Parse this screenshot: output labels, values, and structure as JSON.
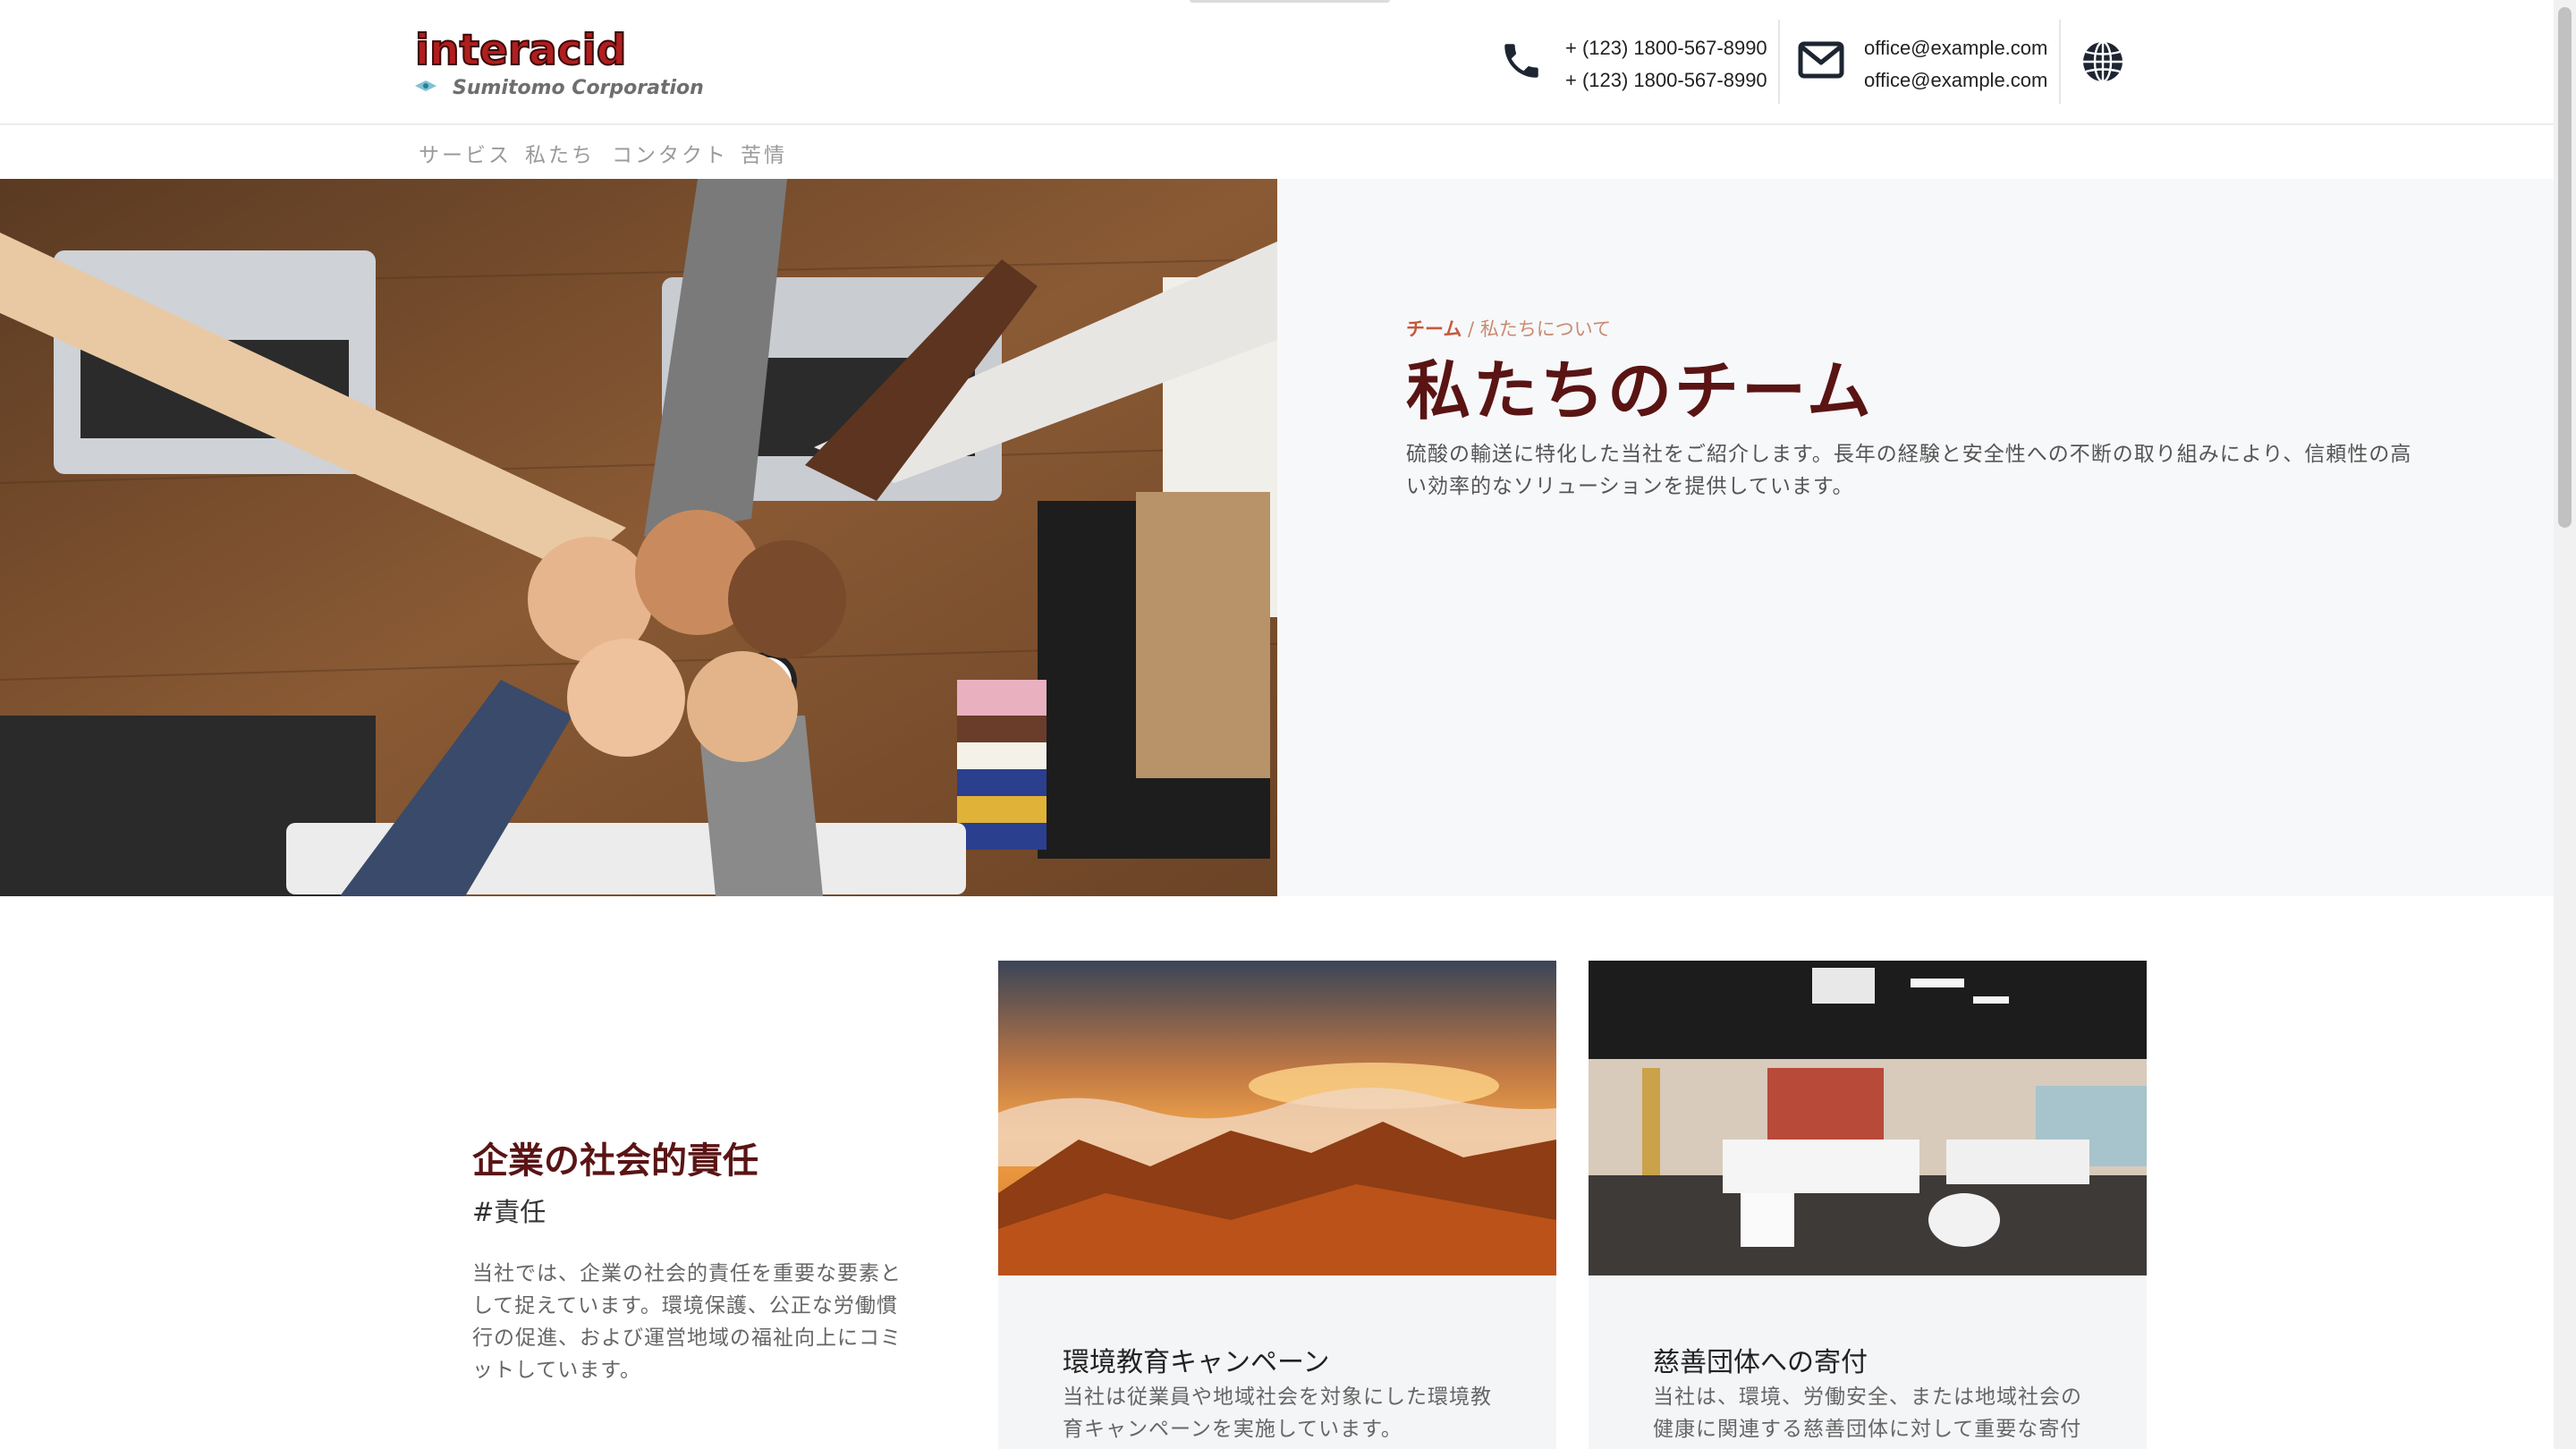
{
  "header": {
    "logo": {
      "wordmark": "interacid",
      "subtitle": "Sumitomo Corporation"
    },
    "phones": [
      "+ (123) 1800-567-8990",
      "+ (123) 1800-567-8990"
    ],
    "emails": [
      "office@example.com",
      "office@example.com"
    ],
    "icons": {
      "phone": "phone-icon",
      "email": "envelope-icon",
      "language": "globe-icon"
    }
  },
  "nav": {
    "items": [
      {
        "label": "サービス"
      },
      {
        "label": "私たち"
      },
      {
        "label": "コンタクト"
      },
      {
        "label": "苦情"
      }
    ]
  },
  "hero": {
    "breadcrumb_active": "チーム",
    "breadcrumb_rest": " / 私たちについて",
    "title": "私たちのチーム",
    "description": "硫酸の輸送に特化した当社をご紹介します。長年の経験と安全性への不断の取り組みにより、信頼性の高い効率的なソリューションを提供しています。"
  },
  "csr": {
    "title": "企業の社会的責任",
    "tag": "#責任",
    "text": "当社では、企業の社会的責任を重要な要素として捉えています。環境保護、公正な労働慣行の促進、および運営地域の福祉向上にコミットしています。"
  },
  "cards": [
    {
      "title": "環境教育キャンペーン",
      "text": "当社は従業員や地域社会を対象にした環境教育キャンペーンを実施しています。"
    },
    {
      "title": "慈善団体への寄付",
      "text": "当社は、環境、労働安全、または地域社会の健康に関連する慈善団体に対して重要な寄付"
    }
  ],
  "colors": {
    "brand": "#5a1414",
    "accent": "#c8573a",
    "logo_red": "#b01e1e"
  }
}
